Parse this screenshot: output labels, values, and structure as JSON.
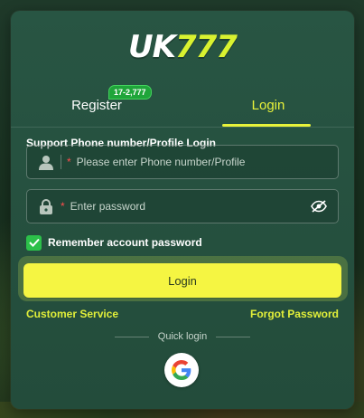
{
  "brand": {
    "logo_uk": "UK",
    "logo_num": "777",
    "colors": {
      "accent": "#e8f23a",
      "card": "#285543",
      "success": "#2cc04a"
    }
  },
  "tabs": {
    "register_label": "Register",
    "register_badge": "17-2,777",
    "login_label": "Login",
    "active": "login"
  },
  "form": {
    "section_label": "Support Phone number/Profile Login",
    "phone": {
      "required_mark": "*",
      "placeholder": "Please enter Phone number/Profile",
      "value": "",
      "icon": "user-icon"
    },
    "password": {
      "required_mark": "*",
      "placeholder": "Enter password",
      "value": "",
      "icon": "lock-icon",
      "toggle_icon": "eye-off-icon"
    },
    "remember": {
      "label": "Remember account password",
      "checked": true
    }
  },
  "actions": {
    "login_label": "Login",
    "customer_service": "Customer Service",
    "forgot_password": "Forgot Password"
  },
  "quick_login": {
    "label": "Quick login",
    "providers": [
      "google-icon"
    ]
  }
}
